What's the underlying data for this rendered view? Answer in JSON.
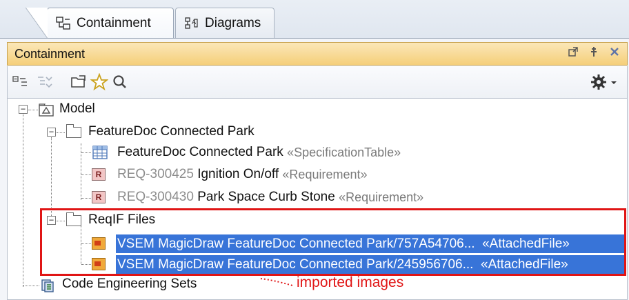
{
  "tabs": [
    {
      "label": "Containment",
      "icon": "containment-tree-icon",
      "active": true
    },
    {
      "label": "Diagrams",
      "icon": "diagrams-icon",
      "active": false
    }
  ],
  "panel": {
    "title": "Containment",
    "header_buttons": [
      "undock-icon",
      "pin-icon",
      "close-icon"
    ]
  },
  "toolbar": {
    "buttons": [
      "collapse-all-icon",
      "expand-all-icon",
      "open-folder-icon",
      "favorites-star-icon",
      "search-icon"
    ],
    "options_button": "gear-icon"
  },
  "tree": {
    "model": "Model",
    "featuredoc_package": "FeatureDoc Connected Park",
    "featuredoc_table": {
      "name": "FeatureDoc Connected Park",
      "stereotype": "«SpecificationTable»"
    },
    "req1": {
      "id": "REQ-300425",
      "name": "Ignition On/off",
      "stereotype": "«Requirement»"
    },
    "req2": {
      "id": "REQ-300430",
      "name": "Park Space Curb Stone",
      "stereotype": "«Requirement»"
    },
    "reqif_package": "ReqIF Files",
    "file1": {
      "name": "VSEM MagicDraw FeatureDoc Connected Park/757A54706...",
      "stereotype": "«AttachedFile»"
    },
    "file2": {
      "name": "VSEM MagicDraw FeatureDoc Connected Park/245956706...",
      "stereotype": "«AttachedFile»"
    },
    "code_eng": "Code Engineering Sets"
  },
  "annotation": {
    "text": "imported images",
    "color": "#e01515"
  },
  "colors": {
    "selection": "#3874d8",
    "header": "#f5cf7a",
    "highlight_box": "#e01515"
  }
}
